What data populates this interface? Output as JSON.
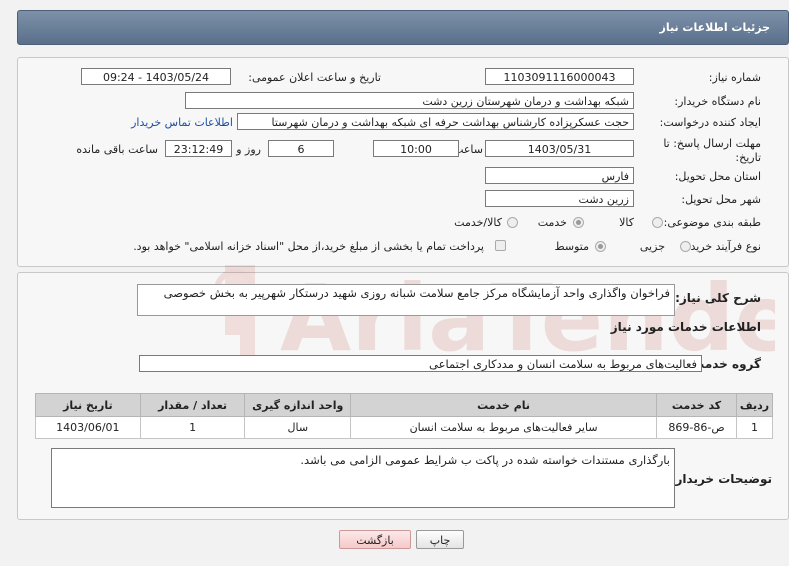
{
  "header": {
    "title": "جزئیات اطلاعات نیاز"
  },
  "form": {
    "need_number": {
      "label": "شماره نیاز:",
      "value": "1103091116000043"
    },
    "announce_datetime": {
      "label": "تاریخ و ساعت اعلان عمومی:",
      "value": "1403/05/24 - 09:24"
    },
    "buyer_org": {
      "label": "نام دستگاه خریدار:",
      "value": "شبکه بهداشت و درمان شهرستان زرین دشت"
    },
    "requester": {
      "label": "ایجاد کننده درخواست:",
      "value": "حجت عسکرپزاده کارشناس بهداشت حرفه ای شبکه بهداشت و درمان شهرستا",
      "contact_link": "اطلاعات تماس خریدار"
    },
    "deadline": {
      "label": "مهلت ارسال پاسخ: تا تاریخ:",
      "date": "1403/05/31",
      "time_label": "ساعت",
      "time": "10:00",
      "days": "6",
      "days_label": "روز و",
      "remaining": "23:12:49",
      "remaining_label": "ساعت باقی مانده"
    },
    "province": {
      "label": "استان محل تحویل:",
      "value": "فارس"
    },
    "city": {
      "label": "شهر محل تحویل:",
      "value": "زرین دشت"
    },
    "category": {
      "label": "طبقه بندی موضوعی:",
      "options": [
        "کالا",
        "خدمت",
        "کالا/خدمت"
      ],
      "selected": "خدمت"
    },
    "process": {
      "label": "نوع فرآیند خرید :",
      "options": [
        "جزیی",
        "متوسط"
      ],
      "selected": "متوسط",
      "payment_note": "پرداخت تمام یا بخشی از مبلغ خرید،از محل \"اسناد خزانه اسلامی\" خواهد بود."
    }
  },
  "summary": {
    "label": "شرح کلی نیاز:",
    "value": "فراخوان واگذاری واحد آزمایشگاه مرکز جامع سلامت شبانه روزی شهید درستکار شهرپیر به بخش خصوصی"
  },
  "services": {
    "heading": "اطلاعات خدمات مورد نیاز",
    "group_label": "گروه خدمت:",
    "group_value": "فعالیت‌های مربوط به سلامت انسان و مددکاری اجتماعی",
    "table": {
      "headers": [
        "ردیف",
        "کد خدمت",
        "نام خدمت",
        "واحد اندازه گیری",
        "تعداد / مقدار",
        "تاریخ نیاز"
      ],
      "rows": [
        [
          "1",
          "ص-86-869",
          "سایر فعالیت‌های مربوط به سلامت انسان",
          "سال",
          "1",
          "1403/06/01"
        ]
      ]
    }
  },
  "buyer_notes": {
    "label": "توضیحات خریدار:",
    "value": "بارگذاری مستندات خواسته شده در پاکت ب شرایط عمومی الزامی می باشد."
  },
  "buttons": {
    "print": "چاپ",
    "back": "بازگشت"
  },
  "watermark": {
    "text": "AriaTender.net"
  }
}
